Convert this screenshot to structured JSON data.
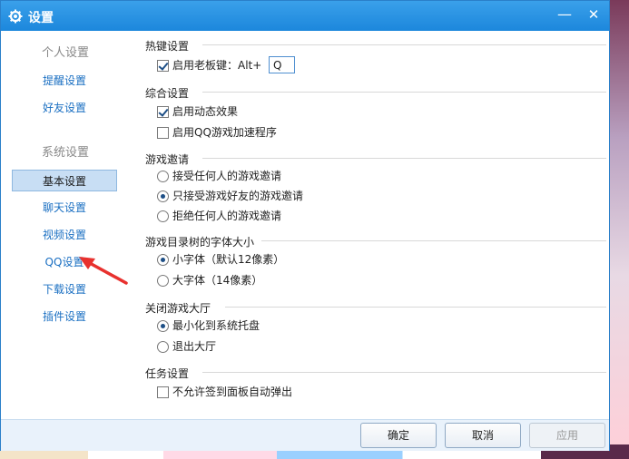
{
  "window": {
    "title": "设置",
    "minimize_glyph": "—",
    "close_glyph": "✕"
  },
  "sidebar": {
    "groups": [
      {
        "label": "个人设置",
        "items": [
          "提醒设置",
          "好友设置"
        ]
      },
      {
        "label": "系统设置",
        "items": [
          "基本设置",
          "聊天设置",
          "视频设置",
          "QQ设置",
          "下载设置",
          "插件设置"
        ]
      }
    ],
    "active": "基本设置"
  },
  "sections": {
    "hotkey": {
      "title": "热键设置",
      "enable_label": "启用老板键：Alt+",
      "enable_checked": true,
      "key_value": "Q"
    },
    "general": {
      "title": "综合设置",
      "dynamic_label": "启用动态效果",
      "dynamic_checked": true,
      "accel_label": "启用QQ游戏加速程序",
      "accel_checked": false
    },
    "invite": {
      "title": "游戏邀请",
      "options": [
        "接受任何人的游戏邀请",
        "只接受游戏好友的游戏邀请",
        "拒绝任何人的游戏邀请"
      ],
      "selected": 1
    },
    "font": {
      "title": "游戏目录树的字体大小",
      "options": [
        "小字体（默认12像素）",
        "大字体（14像素）"
      ],
      "selected": 0
    },
    "close": {
      "title": "关闭游戏大厅",
      "options": [
        "最小化到系统托盘",
        "退出大厅"
      ],
      "selected": 0
    },
    "task": {
      "title": "任务设置",
      "nopopup_label": "不允许签到面板自动弹出",
      "nopopup_checked": false
    }
  },
  "footer": {
    "ok": "确定",
    "cancel": "取消",
    "apply": "应用"
  },
  "colors": {
    "titlebar": "#1c87dc",
    "link": "#1a6fc2",
    "arrow": "#e8312e"
  }
}
